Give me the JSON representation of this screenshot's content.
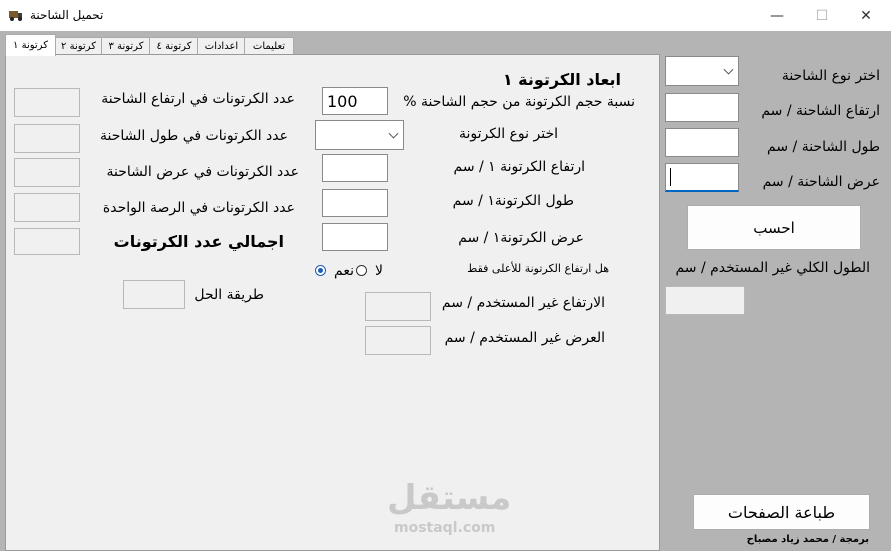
{
  "window": {
    "title": "تحميل الشاحنة",
    "minimize": "—",
    "maximize": "☐",
    "close": "✕"
  },
  "tabs": [
    "كرتونة ١",
    "كرتونة ٢",
    "كرتونة ٣",
    "كرتونة ٤",
    "اعدادات",
    "تعليمات"
  ],
  "carton": {
    "heading": "ابعاد الكرتونة ١",
    "volume_pct_label": "نسبة حجم الكرتونة من حجم الشاحنة %",
    "volume_pct_value": "100",
    "type_label": "اختر نوع الكرتونة",
    "height_label": "ارتفاع الكرتونة ١ / سم",
    "length_label": "طول الكرتونة١ / سم",
    "width_label": "عرض الكرتونة١ / سم",
    "top_only_label": "هل ارتفاع الكرتونة للأعلى فقط",
    "yes_label": "نعم",
    "no_label": "لا",
    "unused_height_label": "الارتفاع غير المستخدم / سم",
    "unused_width_label": "العرض غير المستخدم / سم"
  },
  "counts": {
    "in_height_label": "عدد الكرتونات في ارتفاع الشاحنة",
    "in_length_label": "عدد الكرتونات في طول الشاحنة",
    "in_width_label": "عدد الكرتونات في عرض الشاحنة",
    "in_pallet_label": "عدد الكرتونات في الرصة الواحدة",
    "total_label": "اجمالي عدد الكرتونات",
    "method_label": "طريقة الحل"
  },
  "truck": {
    "type_label": "اختر نوع الشاحنة",
    "height_label": "ارتفاع الشاحنة / سم",
    "length_label": "طول الشاحنة / سم",
    "width_label": "عرض الشاحنة / سم",
    "calc_button": "احسب",
    "unused_length_label": "الطول الكلي غير المستخدم / سم"
  },
  "footer": {
    "print_button": "طباعة الصفحات",
    "credit": "برمجة / محمد زياد مصباح",
    "watermark_ar": "مستقل",
    "watermark_en": "mostaql.com"
  }
}
